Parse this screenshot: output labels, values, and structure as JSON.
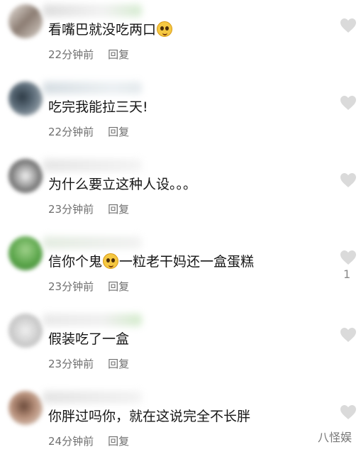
{
  "comments": [
    {
      "text_a": "看嘴巴就没吃两口",
      "emoji": "pleading-face-emoji",
      "text_b": "",
      "time": "22分钟前",
      "reply": "回复"
    },
    {
      "text_a": "吃完我能拉三天!",
      "emoji": "",
      "text_b": "",
      "time": "22分钟前",
      "reply": "回复"
    },
    {
      "text_a": "为什么要立这种人设。。。",
      "emoji": "",
      "text_b": "",
      "time": "23分钟前",
      "reply": "回复"
    },
    {
      "text_a": "信你个鬼",
      "emoji": "tears-of-joy-emoji",
      "text_b": "一粒老干妈还一盒蛋糕",
      "time": "23分钟前",
      "reply": "回复",
      "likes": "1"
    },
    {
      "text_a": "假装吃了一盒",
      "emoji": "",
      "text_b": "",
      "time": "23分钟前",
      "reply": "回复"
    },
    {
      "text_a": "你胖过吗你，就在这说完全不长胖",
      "emoji": "",
      "text_b": "",
      "time": "24分钟前",
      "reply": "回复"
    }
  ],
  "watermark": "八怪娱",
  "colors": {
    "heart": "#dadada",
    "meta_text": "#6f6f6f",
    "body_text": "#161616"
  }
}
